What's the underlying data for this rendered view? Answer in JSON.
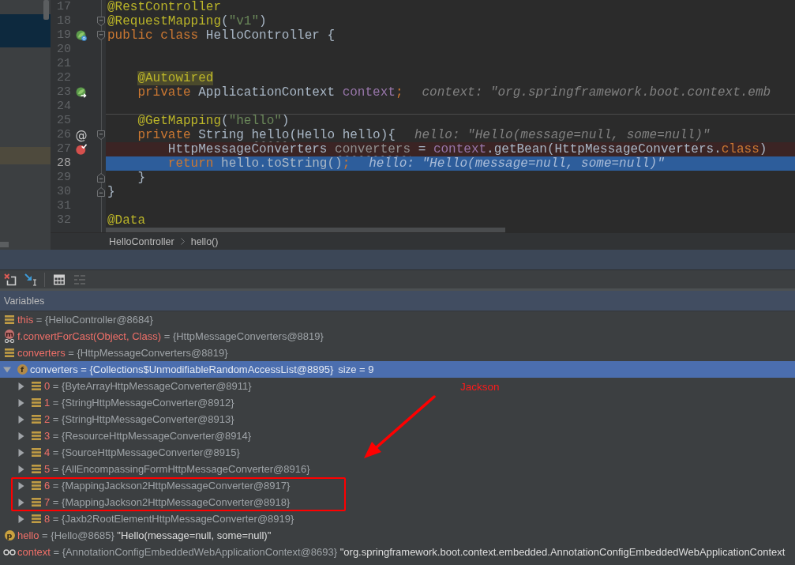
{
  "editor": {
    "lines": [
      {
        "number": "17",
        "kind": "normal",
        "separator": false,
        "tokens": [
          {
            "text": "@RestController",
            "kind": "annotation"
          }
        ]
      },
      {
        "number": "18",
        "kind": "normal",
        "separator": false,
        "fold": {
          "kind": "start"
        },
        "tokens": [
          {
            "text": "@RequestMapping",
            "kind": "annotation"
          },
          {
            "text": "(",
            "kind": "plain"
          },
          {
            "text": "\"v1\"",
            "kind": "string"
          },
          {
            "text": ")",
            "kind": "plain"
          }
        ]
      },
      {
        "number": "19",
        "kind": "normal",
        "separator": false,
        "marker": {
          "kind": "bean"
        },
        "fold": {
          "kind": "start"
        },
        "tokens": [
          {
            "text": "public class",
            "kind": "keyword"
          },
          {
            "text": " HelloController {",
            "kind": "plain"
          }
        ]
      },
      {
        "number": "20",
        "kind": "normal",
        "separator": false
      },
      {
        "number": "21",
        "kind": "normal",
        "separator": false
      },
      {
        "number": "22",
        "kind": "normal",
        "separator": false,
        "tokens": [
          {
            "text": "    @Autowired",
            "kind": "annotation-marked"
          }
        ]
      },
      {
        "number": "23",
        "kind": "normal",
        "separator": false,
        "marker": {
          "kind": "bean-link"
        },
        "tokens": [
          {
            "text": "    private",
            "kind": "keyword"
          },
          {
            "text": " ApplicationContext ",
            "kind": "plain"
          },
          {
            "text": "context",
            "kind": "field"
          },
          {
            "text": ";",
            "kind": "keyword"
          }
        ],
        "hint": "context: \"org.springframework.boot.context.emb"
      },
      {
        "number": "24",
        "kind": "normal",
        "separator": false
      },
      {
        "number": "25",
        "kind": "normal",
        "separator": true,
        "tokens": [
          {
            "text": "    @GetMapping",
            "kind": "annotation"
          },
          {
            "text": "(",
            "kind": "plain"
          },
          {
            "text": "\"hello\"",
            "kind": "string"
          },
          {
            "text": ")",
            "kind": "plain"
          }
        ]
      },
      {
        "number": "26",
        "kind": "normal",
        "separator": false,
        "marker": {
          "kind": "glyph",
          "text": "@"
        },
        "fold": {
          "kind": "start"
        },
        "tokens": [
          {
            "text": "    private",
            "kind": "keyword"
          },
          {
            "text": " String ",
            "kind": "plain"
          },
          {
            "text": "hello",
            "kind": "warning"
          },
          {
            "text": "(Hello hello){",
            "kind": "plain"
          }
        ],
        "hint": "hello: \"Hello(message=null, some=null)\""
      },
      {
        "number": "27",
        "kind": "breakpoint",
        "separator": false,
        "marker": {
          "kind": "breakpoint"
        },
        "tokens": [
          {
            "text": "        HttpMessageConverters ",
            "kind": "plain"
          },
          {
            "text": "converters",
            "kind": "unused"
          },
          {
            "text": " = ",
            "kind": "plain"
          },
          {
            "text": "context",
            "kind": "field"
          },
          {
            "text": ".getBean(HttpMessageConverters.",
            "kind": "plain"
          },
          {
            "text": "class",
            "kind": "keyword"
          },
          {
            "text": ")",
            "kind": "plain"
          }
        ]
      },
      {
        "number": "28",
        "kind": "current",
        "separator": false,
        "tokens": [
          {
            "text": "        return",
            "kind": "keyword"
          },
          {
            "text": " hello.toString()",
            "kind": "plain"
          },
          {
            "text": ";",
            "kind": "keyword"
          }
        ],
        "hint": "hello: \"Hello(message=null, some=null)\""
      },
      {
        "number": "29",
        "kind": "normal",
        "separator": false,
        "fold": {
          "kind": "end"
        },
        "tokens": [
          {
            "text": "    }",
            "kind": "plain"
          }
        ]
      },
      {
        "number": "30",
        "kind": "normal",
        "separator": false,
        "fold": {
          "kind": "end"
        },
        "tokens": [
          {
            "text": "}",
            "kind": "plain"
          }
        ]
      },
      {
        "number": "31",
        "kind": "normal",
        "separator": false
      },
      {
        "number": "32",
        "kind": "normal",
        "separator": false,
        "tokens": [
          {
            "text": "@Data",
            "kind": "annotation"
          }
        ]
      }
    ],
    "breadcrumbs": [
      "HelloController",
      "hello()"
    ]
  },
  "debugger": {
    "toolbar": [
      [
        {
          "disabled": false
        },
        {
          "disabled": false
        }
      ],
      [
        {
          "disabled": false
        },
        {
          "disabled": true
        }
      ]
    ],
    "title": "Variables",
    "variables": [
      {
        "name": "this",
        "value": "= {HelloController@8684}",
        "kind": "local",
        "selected": false
      },
      {
        "name": "f.convertForCast(Object, Class)",
        "value": "= {HttpMessageConverters@8819}",
        "kind": "method-return",
        "badge": "m",
        "selected": false
      },
      {
        "name": "converters",
        "value": "= {HttpMessageConverters@8819}",
        "kind": "local",
        "selected": false
      },
      {
        "name": "converters",
        "value": "= {Collections$UnmodifiableRandomAccessList@8895}",
        "detail": "size = 9",
        "kind": "field",
        "badge": "f",
        "expanded": true,
        "selected": true,
        "children": [
          {
            "name": "0",
            "value": "= {ByteArrayHttpMessageConverter@8911}",
            "kind": "local",
            "expanded": false,
            "selected": false
          },
          {
            "name": "1",
            "value": "= {StringHttpMessageConverter@8912}",
            "kind": "local",
            "expanded": false,
            "selected": false
          },
          {
            "name": "2",
            "value": "= {StringHttpMessageConverter@8913}",
            "kind": "local",
            "expanded": false,
            "selected": false
          },
          {
            "name": "3",
            "value": "= {ResourceHttpMessageConverter@8914}",
            "kind": "local",
            "expanded": false,
            "selected": false
          },
          {
            "name": "4",
            "value": "= {SourceHttpMessageConverter@8915}",
            "kind": "local",
            "expanded": false,
            "selected": false
          },
          {
            "name": "5",
            "value": "= {AllEncompassingFormHttpMessageConverter@8916}",
            "kind": "local",
            "expanded": false,
            "selected": false
          },
          {
            "name": "6",
            "value": "= {MappingJackson2HttpMessageConverter@8917}",
            "kind": "local",
            "expanded": false,
            "selected": false
          },
          {
            "name": "7",
            "value": "= {MappingJackson2HttpMessageConverter@8918}",
            "kind": "local",
            "expanded": false,
            "selected": false
          },
          {
            "name": "8",
            "value": "= {Jaxb2RootElementHttpMessageConverter@8919}",
            "kind": "local",
            "expanded": false,
            "selected": false
          }
        ]
      },
      {
        "name": "hello",
        "value": "= {Hello@8685}",
        "string": "\"Hello(message=null, some=null)\"",
        "kind": "parameter",
        "badge": "p",
        "selected": false
      },
      {
        "name": "context",
        "value": "= {AnnotationConfigEmbeddedWebApplicationContext@8693}",
        "string": "\"org.springframework.boot.context.embedded.AnnotationConfigEmbeddedWebApplicationContext",
        "kind": "watch",
        "selected": false
      }
    ],
    "annotation": {
      "label": "Jackson"
    }
  }
}
